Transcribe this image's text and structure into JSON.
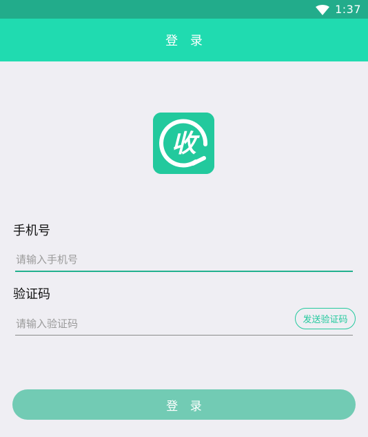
{
  "status_bar": {
    "time": "1:37",
    "wifi_icon": "wifi-icon",
    "background": "#22ac8b"
  },
  "header": {
    "title": "登 录",
    "background": "#20dbb0"
  },
  "logo": {
    "icon": "shou-logo-icon",
    "character": "收",
    "background": "#22c99d"
  },
  "form": {
    "phone": {
      "label": "手机号",
      "placeholder": "请输入手机号",
      "value": ""
    },
    "code": {
      "label": "验证码",
      "placeholder": "请输入验证码",
      "value": "",
      "send_button_label": "发送验证码"
    }
  },
  "login_button": {
    "label": "登 录",
    "background": "#72cbb4"
  }
}
